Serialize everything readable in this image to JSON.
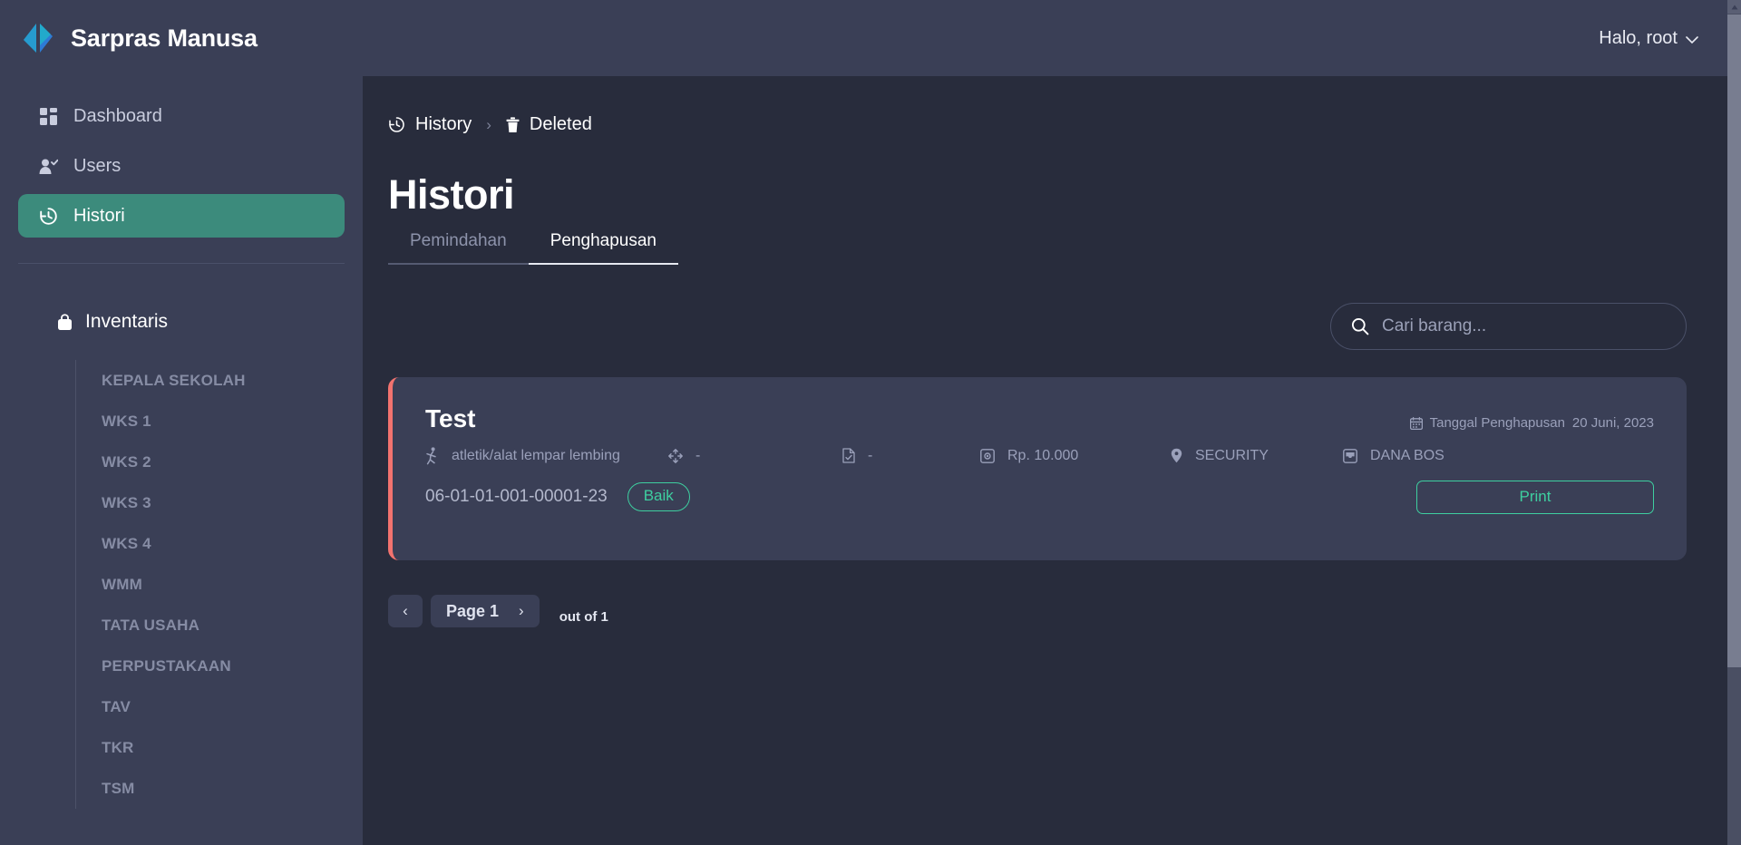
{
  "app": {
    "brand_name": "Sarpras Manusa",
    "logo_icon": "chevron-logo-icon",
    "user_greeting": "Halo, root",
    "caret_icon": "chevron-down-icon"
  },
  "sidebar": {
    "nav": [
      {
        "label": "Dashboard",
        "icon": "dashboard-grid-icon",
        "active": false
      },
      {
        "label": "Users",
        "icon": "user-check-icon",
        "active": false
      },
      {
        "label": "Histori",
        "icon": "history-clock-icon",
        "active": true
      }
    ],
    "section": {
      "label": "Inventaris",
      "icon": "briefcase-bag-icon"
    },
    "sub_items": [
      "KEPALA SEKOLAH",
      "WKS 1",
      "WKS 2",
      "WKS 3",
      "WKS 4",
      "WMM",
      "TATA USAHA",
      "PERPUSTAKAAN",
      "TAV",
      "TKR",
      "TSM"
    ]
  },
  "breadcrumb": {
    "items": [
      {
        "label": "History",
        "icon": "history-clock-icon"
      },
      {
        "label": "Deleted",
        "icon": "trash-icon"
      }
    ],
    "separator": "›"
  },
  "page": {
    "title": "Histori",
    "tabs": [
      {
        "label": "Pemindahan",
        "active": false
      },
      {
        "label": "Penghapusan",
        "active": true
      }
    ]
  },
  "search": {
    "placeholder": "Cari barang...",
    "value": "",
    "icon": "search-icon"
  },
  "items": [
    {
      "name": "Test",
      "date_label": "Tanggal Penghapusan",
      "date_value": "20 Juni, 2023",
      "date_icon": "calendar-icon",
      "category": "atletik/alat lempar lembing",
      "category_icon": "athletics-person-icon",
      "dimension": "-",
      "dimension_icon": "resize-arrows-icon",
      "document": "-",
      "document_icon": "document-check-icon",
      "price": "Rp. 10.000",
      "price_icon": "money-box-icon",
      "location": "SECURITY",
      "location_icon": "map-pin-icon",
      "fund": "DANA BOS",
      "fund_icon": "inbox-icon",
      "code": "06-01-01-001-00001-23",
      "condition": "Baik",
      "print_label": "Print",
      "accent_color": "#f2736f"
    }
  ],
  "pagination": {
    "prev_icon": "chevron-left-icon",
    "next_icon": "chevron-right-icon",
    "page_label": "Page 1",
    "out_of": "out of 1"
  },
  "colors": {
    "sidebar_bg": "#3a3f56",
    "main_bg": "#282c3c",
    "active_nav": "#3c8b7c",
    "accent_green": "#3ecfa0",
    "accent_red": "#f2736f"
  }
}
